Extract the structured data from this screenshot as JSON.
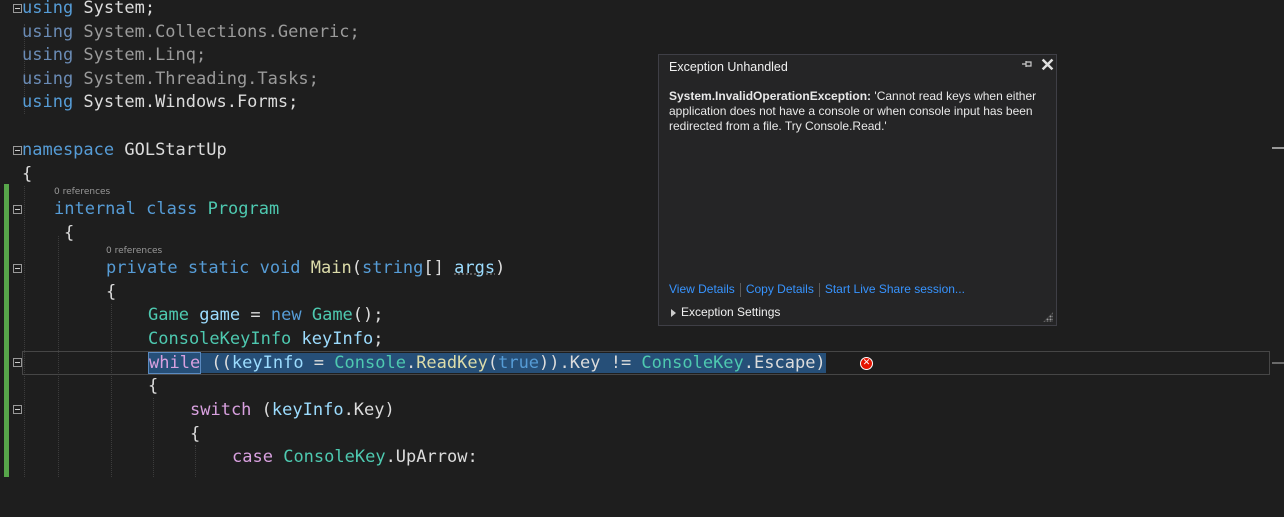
{
  "code": {
    "lines": {
      "l1": {
        "kw": "using",
        "rest": " System;"
      },
      "l2": {
        "kw": "using",
        "rest": " System.Collections.Generic;"
      },
      "l3": {
        "kw": "using",
        "rest": " System.Linq;"
      },
      "l4": {
        "kw": "using",
        "rest": " System.Threading.Tasks;"
      },
      "l5": {
        "kw": "using",
        "rest": " System.Windows.Forms;"
      },
      "l7": {
        "kw": "namespace",
        "rest": " GOLStartUp"
      },
      "l8": {
        "text": "{"
      },
      "l9": {
        "kw1": "internal",
        "kw2": "class",
        "type": "Program"
      },
      "l10": {
        "text": "{"
      },
      "l11": {
        "kw1": "private",
        "kw2": "static",
        "kw3": "void",
        "method": "Main",
        "p1": "(",
        "kw4": "string",
        "p2": "[] ",
        "param": "args",
        "p3": ")"
      },
      "l12": {
        "text": "{"
      },
      "l13": {
        "type1": "Game",
        "var": "game",
        "eq": " = ",
        "kw": "new",
        "type2": "Game",
        "end": "();"
      },
      "l14": {
        "type": "ConsoleKeyInfo",
        "var": "keyInfo",
        "end": ";"
      },
      "l15": {
        "kw": "while",
        "a": " ((",
        "var1": "keyInfo",
        "b": " = ",
        "type1": "Console",
        "c": ".",
        "method": "ReadKey",
        "d": "(",
        "kw2": "true",
        "e": ")).",
        "f": "Key != ",
        "type2": "ConsoleKey",
        "g": ".Escape)"
      },
      "l16": {
        "text": "{"
      },
      "l17": {
        "kw": "switch",
        "a": " (",
        "var": "keyInfo",
        "b": ".Key)"
      },
      "l18": {
        "text": "{"
      },
      "l19": {
        "kw": "case",
        "type": "ConsoleKey",
        "rest": ".UpArrow:"
      }
    },
    "codelens": {
      "class_refs": "0 references",
      "main_refs": "0 references"
    }
  },
  "exception_popup": {
    "title": "Exception Unhandled",
    "exception_type": "System.InvalidOperationException:",
    "message": " 'Cannot read keys when either application does not have a console or when console input has been redirected from a file. Try Console.Read.'",
    "links": {
      "view_details": "View Details",
      "copy_details": "Copy Details",
      "live_share": "Start Live Share session..."
    },
    "settings_label": "Exception Settings"
  },
  "colors": {
    "background": "#1e1e1e",
    "keyword": "#569cd6",
    "control_keyword": "#d8a0df",
    "type": "#4ec9b0",
    "identifier": "#9cdcfe",
    "method": "#dcdcaa",
    "error": "#e51400",
    "link": "#3794ff"
  },
  "icons": {
    "pin": "pin-icon",
    "close": "close-icon",
    "error": "error-icon",
    "expand": "triangle-right-icon"
  }
}
